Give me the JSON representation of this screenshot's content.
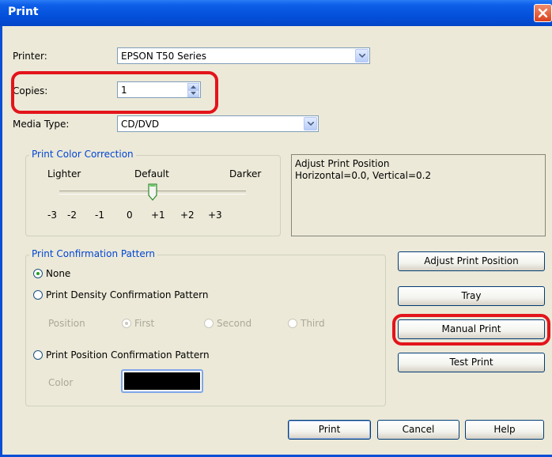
{
  "window": {
    "title": "Print"
  },
  "form": {
    "printer_label": "Printer:",
    "printer_value": "EPSON T50 Series",
    "copies_label": "Copies:",
    "copies_value": "1",
    "media_label": "Media Type:",
    "media_value": "CD/DVD"
  },
  "color_correction": {
    "title": "Print Color Correction",
    "lighter": "Lighter",
    "default": "Default",
    "darker": "Darker",
    "ticks": [
      "-3",
      "-2",
      "-1",
      "0",
      "+1",
      "+2",
      "+3"
    ],
    "value": "0"
  },
  "adjust_info": {
    "line1": "Adjust Print Position",
    "line2": "Horizontal=0.0, Vertical=0.2"
  },
  "confirmation": {
    "title": "Print Confirmation Pattern",
    "none": "None",
    "density": "Print Density Confirmation Pattern",
    "position_label": "Position",
    "first": "First",
    "second": "Second",
    "third": "Third",
    "position_pattern": "Print Position Confirmation Pattern",
    "color_label": "Color",
    "color_value": "#000000",
    "selected": "None"
  },
  "buttons": {
    "adjust": "Adjust Print Position",
    "tray": "Tray",
    "manual": "Manual Print",
    "test": "Test Print",
    "print": "Print",
    "cancel": "Cancel",
    "help": "Help"
  },
  "colors": {
    "highlight": "#e3141b",
    "group_title": "#0046d5"
  }
}
